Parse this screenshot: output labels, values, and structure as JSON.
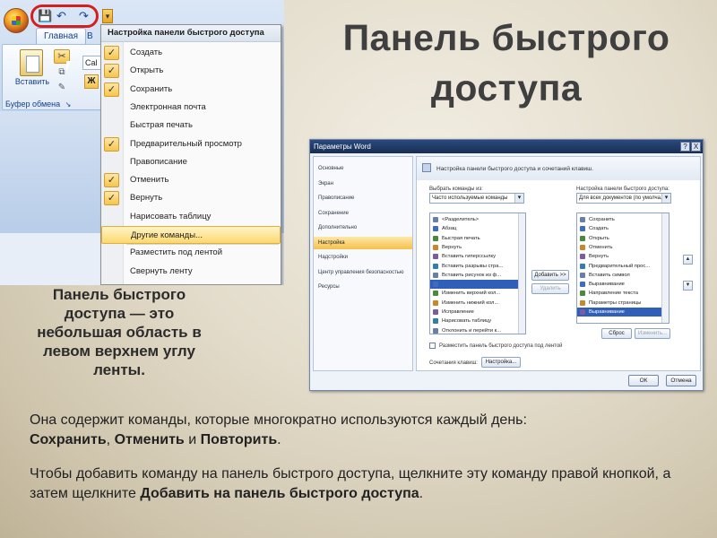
{
  "slide": {
    "title_line1": "Панель быстрого",
    "title_line2": "доступа",
    "caption_lines": [
      "Панель быстрого",
      "доступа — это",
      "небольшая область в",
      "левом верхнем углу",
      "ленты."
    ],
    "para1": {
      "text": "Она содержит команды, которые многократно используются каждый день:",
      "bold1": "Сохранить",
      "sep1": ", ",
      "bold2": "Отменить",
      "sep2": " и ",
      "bold3": "Повторить",
      "end": "."
    },
    "para2": {
      "text": "Чтобы добавить команду на панель быстрого доступа, щелкните эту команду правой кнопкой, а затем щелкните",
      "bold": "Добавить на панель быстрого доступа",
      "end": "."
    }
  },
  "ribbon": {
    "tab_home": "Главная",
    "tab_next": "В",
    "paste_label": "Вставить",
    "buffer_label": "Буфер обмена",
    "font_box": "Cal",
    "bold_glyph": "Ж",
    "qat_icons": [
      "💾",
      "↶",
      "↷"
    ],
    "colors": {
      "ring": "#d41f1f",
      "ribbon": "#c7d9f0"
    }
  },
  "qat_menu": {
    "header": "Настройка панели быстрого доступа",
    "items": [
      {
        "label": "Создать",
        "checked": true
      },
      {
        "label": "Открыть",
        "checked": true
      },
      {
        "label": "Сохранить",
        "checked": true
      },
      {
        "label": "Электронная почта",
        "checked": false
      },
      {
        "label": "Быстрая печать",
        "checked": false
      },
      {
        "label": "Предварительный просмотр",
        "checked": true
      },
      {
        "label": "Правописание",
        "checked": false
      },
      {
        "label": "Отменить",
        "checked": true
      },
      {
        "label": "Вернуть",
        "checked": true
      },
      {
        "label": "Нарисовать таблицу",
        "checked": false
      },
      {
        "label": "Другие команды...",
        "checked": false,
        "highlight": true
      },
      {
        "label": "Разместить под лентой",
        "checked": false
      },
      {
        "label": "Свернуть ленту",
        "checked": false
      }
    ]
  },
  "dialog": {
    "title": "Параметры Word",
    "title_buttons": [
      "?",
      "X"
    ],
    "nav": [
      "Основные",
      "Экран",
      "Правописание",
      "Сохранение",
      "Дополнительно",
      "Настройка",
      "Надстройки",
      "Центр управления безопасностью",
      "Ресурсы"
    ],
    "nav_selected": 5,
    "heading": "Настройка панели быстрого доступа и сочетаний клавиш.",
    "left_label": "Выбрать команды из:",
    "left_combo": "Часто используемые команды",
    "right_label": "Настройка панели быстрого доступа:",
    "right_combo": "Для всех документов (по умолча...",
    "left_list": [
      "<Разделитель>",
      "Абзац",
      "Быстрая печать",
      "Вернуть",
      "Вставить гиперссылку",
      "Вставить разрывы стра...",
      "Вставить рисунок из ф...",
      "",
      "Изменить верхний кол...",
      "Изменить нижний кол...",
      "Исправление",
      "Нарисовать таблицу",
      "Отклонить и перейти к..."
    ],
    "left_list_selected": 7,
    "right_list": [
      "Сохранить",
      "Создать",
      "Открыть",
      "Отменить",
      "Вернуть",
      "Предварительный прос...",
      "Вставить символ",
      "Выравнивание",
      "Направление текста",
      "Параметры страницы",
      "Выравнивание"
    ],
    "right_list_selected": 10,
    "add_button": "Добавить >>",
    "remove_button": "Удалить",
    "reset_button": "Сброс",
    "modify_button": "Изменить...",
    "checkbox_label": "Разместить панель быстрого доступа под лентой",
    "shortcuts_label": "Сочетания клавиш:",
    "shortcuts_button": "Настройка...",
    "ok": "ОК",
    "cancel": "Отмена"
  }
}
